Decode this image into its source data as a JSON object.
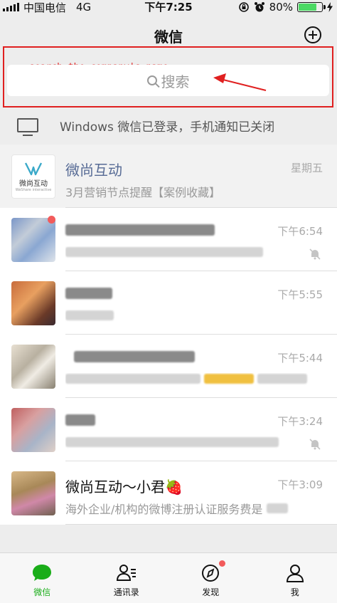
{
  "status_bar": {
    "carrier": "中国电信",
    "network": "4G",
    "time": "下午7:25",
    "battery_percent": "80%",
    "battery_level": 0.8
  },
  "nav": {
    "title": "微信",
    "add_icon": "plus-circle-icon"
  },
  "search": {
    "annotation": "search the company's name",
    "placeholder": "搜索",
    "highlight_color": "#e02020"
  },
  "login_notice": {
    "text": "Windows 微信已登录，手机通知已关闭"
  },
  "chats": [
    {
      "name": "微尚互动",
      "time": "星期五",
      "preview": "3月营销节点提醒【案例收藏】",
      "logo_text": "微尚互动",
      "logo_sub": "WeShare interactive"
    },
    {
      "name": "",
      "time": "下午6:54",
      "muted": true,
      "unread": true
    },
    {
      "name": "",
      "time": "下午5:55"
    },
    {
      "name": "",
      "time": "下午5:44"
    },
    {
      "name": "",
      "time": "下午3:24",
      "muted": true
    },
    {
      "name": "微尚互动～小君🍓",
      "time": "下午3:09",
      "preview": "海外企业/机构的微博注册认证服务费是"
    }
  ],
  "tabs": [
    {
      "label": "微信",
      "icon": "chat-bubble-icon",
      "active": true
    },
    {
      "label": "通讯录",
      "icon": "contacts-icon"
    },
    {
      "label": "发现",
      "icon": "compass-icon",
      "badge": true
    },
    {
      "label": "我",
      "icon": "person-icon"
    }
  ],
  "colors": {
    "accent": "#1aad19",
    "link": "#576b95",
    "badge": "#f25b5b"
  }
}
